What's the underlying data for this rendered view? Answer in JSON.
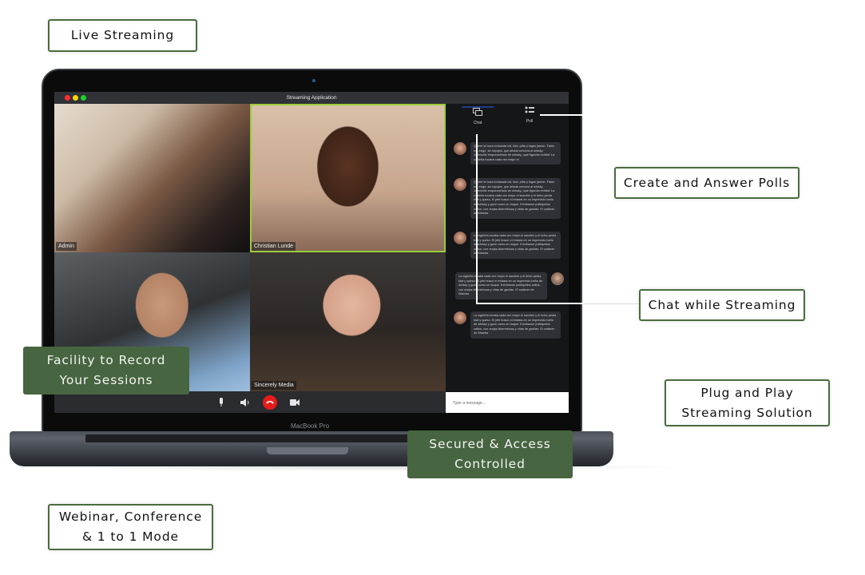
{
  "callouts": {
    "live_streaming": "Live Streaming",
    "create_answer_polls": "Create and Answer Polls",
    "chat_while_streaming": "Chat while Streaming",
    "plug_and_play_line1": "Plug and Play",
    "plug_and_play_line2": "Streaming Solution",
    "webinar_line1": "Webinar, Conference",
    "webinar_line2": "& 1 to 1 Mode",
    "record_line1": "Facility to Record",
    "record_line2": "Your Sessions",
    "secured_line1": "Secured & Access",
    "secured_line2": "Controlled"
  },
  "colors": {
    "accent_green": "#476540",
    "outline_green": "#4a6b3e",
    "end_call_red": "#e81b1b",
    "active_speaker_border": "#9ccc3a"
  },
  "app": {
    "window_title": "Streaming Application",
    "participants": [
      {
        "name": "Admin"
      },
      {
        "name": "Christian Lunde"
      },
      {
        "name": ""
      },
      {
        "name": "Sincerely Media"
      }
    ],
    "controls": {
      "mic_icon": "microphone-icon",
      "speaker_icon": "speaker-icon",
      "end_call_icon": "phone-hangup-icon",
      "camera_icon": "video-camera-icon"
    },
    "chat_panel": {
      "tabs": [
        {
          "label": "Chat",
          "icon": "chat-bubbles-icon",
          "active": true
        },
        {
          "label": "Poll",
          "icon": "poll-list-icon",
          "active": false
        }
      ],
      "messages": [
        {
          "side": "left",
          "text": "Quiere la boca exhausta vid, kiwi, piña y fugaz jamón. Fabio me exige, sin tapujos, que añada cerveza al whisky. Jovencillo emponzoñado de whisky, ¡qué figurota exhibe! La cigüeña tocaba cada vez mejor el"
        },
        {
          "side": "left",
          "text": "Quiere la boca exhausta vid, kiwi, piña y fugaz jamón. Fabio me exige, sin tapujos, que añada cerveza al whisky. Jovencillo emponzoñado de whisky, ¡qué figurota exhibe! La cigüeña tocaba cada vez mejor el saxofón y el búho pedía kiwi y queso. El jefe buscó el éxtasis en un imprevisto baño de whisky y gozó como un duque. Exhíbanse politiquillos zafios, con orejas kilométricas y uñas de gavilán. El cadáver de Wamba"
        },
        {
          "side": "left",
          "text": "La cigüeña tocaba cada vez mejor el saxofón y el búho pedía kiwi y queso. El jefe buscó el éxtasis en un imprevisto baño de whisky y gozó como un duque. Exhíbanse politiquillos zafios, con orejas kilométricas y uñas de gavilán. El cadáver de Wamba"
        },
        {
          "side": "right",
          "text": "La cigüeña tocaba cada vez mejor el saxofón y el búho pedía kiwi y queso. El jefe buscó el éxtasis en un imprevisto baño de whisky y gozó como un duque. Exhíbanse politiquillos zafios, con orejas kilométricas y uñas de gavilán. El cadáver de Wamba"
        },
        {
          "side": "left",
          "text": "La cigüeña tocaba cada vez mejor el saxofón y el búho pedía kiwi y queso. El jefe buscó el éxtasis en un imprevisto baño de whisky y gozó como un duque. Exhíbanse politiquillos zafios, con orejas kilométricas y uñas de gavilán. El cadáver de Wamba"
        }
      ],
      "input_placeholder": "Type a message..."
    }
  },
  "device": {
    "brand_label": "MacBook Pro"
  }
}
